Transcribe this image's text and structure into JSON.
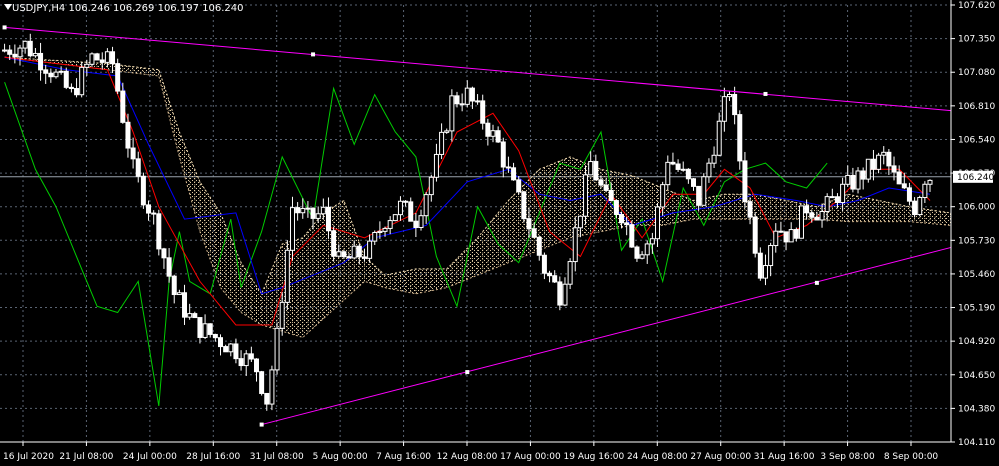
{
  "header": {
    "symbol": "USDJPY,H4",
    "open": "106.246",
    "high": "106.269",
    "low": "106.197",
    "close": "106.240"
  },
  "current_price_label": "106.240",
  "colors": {
    "background": "#000000",
    "grid": "#5a6473",
    "axis": "#ffffff",
    "candle": "#ffffff",
    "tenkan": "#ff0000",
    "kijun": "#0000ff",
    "chikou": "#00cc00",
    "cloud_a": "#f5deb3",
    "cloud_b": "#ffffff",
    "trendline": "#ff00ff"
  },
  "chart_data": {
    "type": "candlestick",
    "instrument": "USDJPY",
    "timeframe": "H4",
    "ylim": [
      104.11,
      107.62
    ],
    "y_ticks": [
      "107.620",
      "107.350",
      "107.080",
      "106.810",
      "106.540",
      "106.270",
      "106.000",
      "105.730",
      "105.460",
      "105.190",
      "104.920",
      "104.650",
      "104.380",
      "104.110"
    ],
    "x_ticks": [
      "16 Jul 2020",
      "21 Jul 08:00",
      "24 Jul 00:00",
      "28 Jul 16:00",
      "31 Jul 08:00",
      "5 Aug 00:00",
      "7 Aug 16:00",
      "12 Aug 08:00",
      "17 Aug 00:00",
      "19 Aug 16:00",
      "24 Aug 08:00",
      "27 Aug 00:00",
      "31 Aug 16:00",
      "3 Sep 08:00",
      "8 Sep 00:00"
    ],
    "indicators": [
      "Ichimoku Kinko Hyo"
    ],
    "close_path": [
      [
        0,
        107.25
      ],
      [
        5,
        107.3
      ],
      [
        10,
        107.1
      ],
      [
        14,
        106.9
      ],
      [
        18,
        107.2
      ],
      [
        22,
        107.15
      ],
      [
        26,
        106.3
      ],
      [
        30,
        105.9
      ],
      [
        34,
        105.3
      ],
      [
        38,
        105.05
      ],
      [
        42,
        104.95
      ],
      [
        46,
        104.85
      ],
      [
        50,
        104.7
      ],
      [
        52,
        104.45
      ],
      [
        54,
        104.95
      ],
      [
        57,
        106.0
      ],
      [
        60,
        105.9
      ],
      [
        63,
        105.95
      ],
      [
        66,
        105.55
      ],
      [
        69,
        105.6
      ],
      [
        72,
        105.65
      ],
      [
        75,
        105.9
      ],
      [
        78,
        106.0
      ],
      [
        81,
        105.9
      ],
      [
        85,
        106.35
      ],
      [
        88,
        106.85
      ],
      [
        91,
        106.9
      ],
      [
        94,
        106.7
      ],
      [
        97,
        106.5
      ],
      [
        100,
        106.15
      ],
      [
        103,
        105.85
      ],
      [
        106,
        105.5
      ],
      [
        109,
        105.3
      ],
      [
        112,
        105.8
      ],
      [
        115,
        106.35
      ],
      [
        118,
        106.05
      ],
      [
        121,
        105.95
      ],
      [
        124,
        105.65
      ],
      [
        127,
        105.75
      ],
      [
        130,
        106.4
      ],
      [
        133,
        106.25
      ],
      [
        136,
        106.05
      ],
      [
        139,
        106.5
      ],
      [
        142,
        106.95
      ],
      [
        145,
        106.1
      ],
      [
        148,
        105.5
      ],
      [
        151,
        105.85
      ],
      [
        154,
        105.75
      ],
      [
        157,
        106.0
      ],
      [
        160,
        105.95
      ],
      [
        163,
        106.1
      ],
      [
        166,
        106.2
      ],
      [
        169,
        106.3
      ],
      [
        172,
        106.4
      ],
      [
        175,
        106.15
      ],
      [
        178,
        106.0
      ],
      [
        180,
        106.24
      ]
    ],
    "ichimoku": {
      "tenkan_sen": [
        [
          0,
          107.2
        ],
        [
          10,
          107.15
        ],
        [
          20,
          107.1
        ],
        [
          25,
          106.6
        ],
        [
          30,
          106.0
        ],
        [
          38,
          105.4
        ],
        [
          45,
          105.05
        ],
        [
          52,
          105.05
        ],
        [
          56,
          105.6
        ],
        [
          62,
          105.85
        ],
        [
          70,
          105.75
        ],
        [
          80,
          105.95
        ],
        [
          88,
          106.6
        ],
        [
          95,
          106.75
        ],
        [
          100,
          106.45
        ],
        [
          106,
          105.8
        ],
        [
          112,
          105.6
        ],
        [
          118,
          106.1
        ],
        [
          124,
          105.75
        ],
        [
          130,
          106.1
        ],
        [
          136,
          106.1
        ],
        [
          140,
          106.3
        ],
        [
          145,
          106.15
        ],
        [
          150,
          105.75
        ],
        [
          156,
          105.85
        ],
        [
          162,
          106.05
        ],
        [
          168,
          106.3
        ],
        [
          174,
          106.3
        ],
        [
          180,
          106.05
        ]
      ],
      "kijun_sen": [
        [
          0,
          107.2
        ],
        [
          12,
          107.1
        ],
        [
          22,
          107.05
        ],
        [
          28,
          106.5
        ],
        [
          35,
          105.9
        ],
        [
          45,
          105.95
        ],
        [
          50,
          105.3
        ],
        [
          54,
          105.35
        ],
        [
          60,
          105.45
        ],
        [
          66,
          105.55
        ],
        [
          72,
          105.75
        ],
        [
          82,
          105.85
        ],
        [
          90,
          106.2
        ],
        [
          98,
          106.3
        ],
        [
          104,
          106.1
        ],
        [
          110,
          106.05
        ],
        [
          116,
          106.1
        ],
        [
          122,
          105.85
        ],
        [
          130,
          105.95
        ],
        [
          138,
          106.0
        ],
        [
          146,
          106.1
        ],
        [
          154,
          106.05
        ],
        [
          160,
          106.0
        ],
        [
          166,
          106.05
        ],
        [
          172,
          106.15
        ],
        [
          180,
          106.1
        ]
      ],
      "chikou_span": [
        [
          0,
          107.0
        ],
        [
          6,
          106.3
        ],
        [
          10,
          106.0
        ],
        [
          14,
          105.6
        ],
        [
          18,
          105.2
        ],
        [
          22,
          105.15
        ],
        [
          26,
          105.4
        ],
        [
          30,
          104.4
        ],
        [
          32,
          105.4
        ],
        [
          34,
          105.8
        ],
        [
          36,
          105.4
        ],
        [
          40,
          105.3
        ],
        [
          44,
          105.9
        ],
        [
          46,
          105.35
        ],
        [
          50,
          105.8
        ],
        [
          54,
          106.4
        ],
        [
          60,
          105.9
        ],
        [
          64,
          106.95
        ],
        [
          68,
          106.5
        ],
        [
          72,
          106.9
        ],
        [
          76,
          106.6
        ],
        [
          80,
          106.4
        ],
        [
          84,
          105.6
        ],
        [
          88,
          105.2
        ],
        [
          92,
          106.0
        ],
        [
          96,
          105.7
        ],
        [
          100,
          105.55
        ],
        [
          104,
          105.95
        ],
        [
          108,
          106.35
        ],
        [
          112,
          106.3
        ],
        [
          116,
          106.6
        ],
        [
          120,
          105.65
        ],
        [
          124,
          105.9
        ],
        [
          128,
          105.4
        ],
        [
          132,
          106.15
        ],
        [
          136,
          105.85
        ],
        [
          140,
          106.2
        ],
        [
          144,
          106.3
        ],
        [
          148,
          106.35
        ],
        [
          152,
          106.2
        ],
        [
          156,
          106.15
        ],
        [
          160,
          106.35
        ]
      ],
      "senkou_span_a": [
        [
          0,
          107.2
        ],
        [
          20,
          107.15
        ],
        [
          30,
          107.1
        ],
        [
          34,
          106.6
        ],
        [
          38,
          106.2
        ],
        [
          42,
          105.95
        ],
        [
          46,
          105.55
        ],
        [
          50,
          105.3
        ],
        [
          54,
          105.7
        ],
        [
          58,
          105.75
        ],
        [
          62,
          105.95
        ],
        [
          66,
          106.05
        ],
        [
          70,
          105.6
        ],
        [
          74,
          105.45
        ],
        [
          80,
          105.5
        ],
        [
          86,
          105.5
        ],
        [
          92,
          105.75
        ],
        [
          98,
          106.05
        ],
        [
          104,
          106.3
        ],
        [
          110,
          106.4
        ],
        [
          116,
          106.3
        ],
        [
          122,
          106.25
        ],
        [
          128,
          106.15
        ],
        [
          134,
          106.05
        ],
        [
          140,
          106.1
        ],
        [
          146,
          106.1
        ],
        [
          152,
          106.05
        ],
        [
          158,
          106.0
        ],
        [
          164,
          106.1
        ],
        [
          170,
          106.05
        ],
        [
          176,
          106.0
        ],
        [
          184,
          105.95
        ]
      ],
      "senkou_span_b": [
        [
          0,
          107.2
        ],
        [
          20,
          107.1
        ],
        [
          30,
          107.05
        ],
        [
          34,
          106.4
        ],
        [
          38,
          105.8
        ],
        [
          42,
          105.35
        ],
        [
          46,
          105.15
        ],
        [
          50,
          105.05
        ],
        [
          54,
          105.0
        ],
        [
          58,
          104.95
        ],
        [
          62,
          105.1
        ],
        [
          66,
          105.25
        ],
        [
          70,
          105.4
        ],
        [
          74,
          105.35
        ],
        [
          80,
          105.3
        ],
        [
          86,
          105.35
        ],
        [
          92,
          105.45
        ],
        [
          98,
          105.55
        ],
        [
          104,
          105.65
        ],
        [
          110,
          105.75
        ],
        [
          116,
          105.8
        ],
        [
          122,
          105.85
        ],
        [
          128,
          105.85
        ],
        [
          134,
          105.9
        ],
        [
          140,
          105.9
        ],
        [
          146,
          105.9
        ],
        [
          152,
          105.9
        ],
        [
          158,
          105.9
        ],
        [
          164,
          105.88
        ],
        [
          170,
          105.88
        ],
        [
          176,
          105.88
        ],
        [
          184,
          105.85
        ]
      ]
    },
    "trendlines": [
      {
        "name": "upper",
        "points": [
          [
            0,
            107.44
          ],
          [
            180,
            106.79
          ]
        ]
      },
      {
        "name": "lower",
        "points": [
          [
            50,
            104.25
          ],
          [
            180,
            105.62
          ]
        ]
      }
    ],
    "grid": true
  }
}
